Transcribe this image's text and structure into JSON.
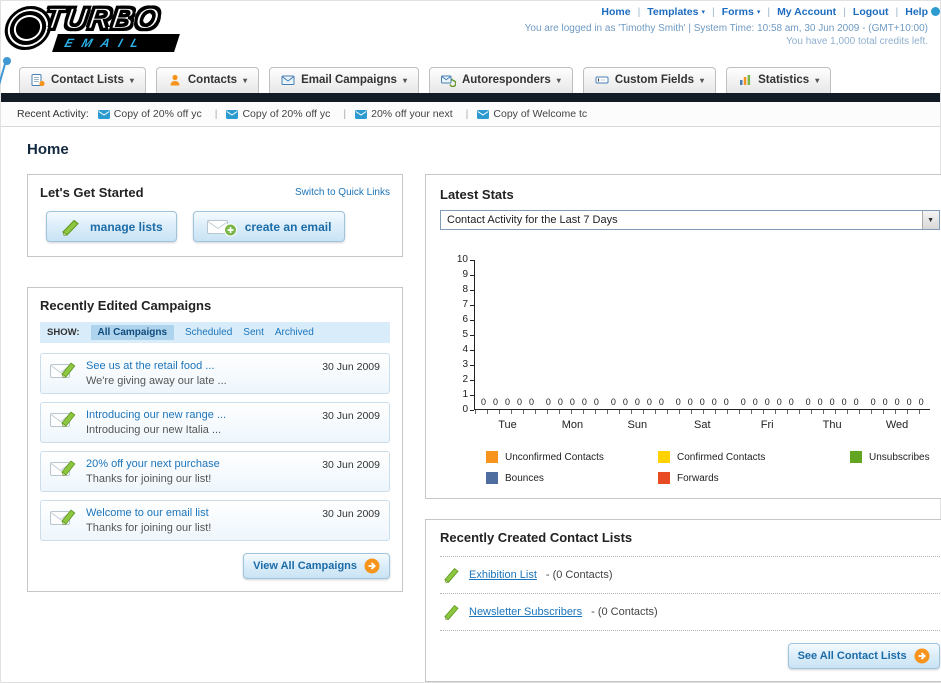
{
  "header": {
    "logo_title": "TURBO",
    "logo_subtitle": "EMAIL",
    "nav_links": [
      "Home",
      "Templates",
      "Forms",
      "My Account",
      "Logout",
      "Help"
    ],
    "login_info": "You are logged in as 'Timothy Smith' | System Time: 10:58 am, 30 Jun 2009 - (GMT+10:00)",
    "credits_info": "You have 1,000 total credits left."
  },
  "nav_tabs": [
    {
      "label": "Contact Lists"
    },
    {
      "label": "Contacts"
    },
    {
      "label": "Email Campaigns"
    },
    {
      "label": "Autoresponders"
    },
    {
      "label": "Custom Fields"
    },
    {
      "label": "Statistics"
    }
  ],
  "recent_activity": {
    "label": "Recent Activity:",
    "items": [
      "Copy of 20% off yc",
      "Copy of 20% off yc",
      "20% off your next",
      "Copy of Welcome tc"
    ]
  },
  "page_title": "Home",
  "get_started": {
    "title": "Let's Get Started",
    "switch_link": "Switch to Quick Links",
    "manage_lists_label": "manage lists",
    "create_email_label": "create an email"
  },
  "campaigns": {
    "title": "Recently Edited Campaigns",
    "show_label": "SHOW:",
    "filters": [
      "All Campaigns",
      "Scheduled",
      "Sent",
      "Archived"
    ],
    "active_filter": "All Campaigns",
    "items": [
      {
        "title": "See us at the retail food ...",
        "subtitle": "We're giving away our late ...",
        "date": "30 Jun 2009"
      },
      {
        "title": "Introducing our new range ...",
        "subtitle": "Introducing our new Italia ...",
        "date": "30 Jun 2009"
      },
      {
        "title": "20% off your next purchase",
        "subtitle": "Thanks for joining our list!",
        "date": "30 Jun 2009"
      },
      {
        "title": "Welcome to our email list",
        "subtitle": "Thanks for joining our list!",
        "date": "30 Jun 2009"
      }
    ],
    "view_all_label": "View All Campaigns"
  },
  "stats": {
    "title": "Latest Stats",
    "dropdown_value": "Contact Activity for the Last 7 Days",
    "chart_data": {
      "type": "bar",
      "categories": [
        "Tue",
        "Mon",
        "Sun",
        "Sat",
        "Fri",
        "Thu",
        "Wed"
      ],
      "series": [
        {
          "name": "Unconfirmed Contacts",
          "color": "#f7941d",
          "values": [
            0,
            0,
            0,
            0,
            0,
            0,
            0
          ]
        },
        {
          "name": "Confirmed Contacts",
          "color": "#ffd200",
          "values": [
            0,
            0,
            0,
            0,
            0,
            0,
            0
          ]
        },
        {
          "name": "Unsubscribes",
          "color": "#61a521",
          "values": [
            0,
            0,
            0,
            0,
            0,
            0,
            0
          ]
        },
        {
          "name": "Bounces",
          "color": "#4f6d9e",
          "values": [
            0,
            0,
            0,
            0,
            0,
            0,
            0
          ]
        },
        {
          "name": "Forwards",
          "color": "#e74c25",
          "values": [
            0,
            0,
            0,
            0,
            0,
            0,
            0
          ]
        }
      ],
      "ylim": [
        0,
        10
      ],
      "grid": false,
      "legend_position": "bottom"
    }
  },
  "contact_lists": {
    "title": "Recently Created Contact Lists",
    "items": [
      {
        "name": "Exhibition List",
        "suffix": "- (0 Contacts)"
      },
      {
        "name": "Newsletter Subscribers",
        "suffix": "- (0 Contacts)"
      }
    ],
    "see_all_label": "See All Contact Lists"
  }
}
